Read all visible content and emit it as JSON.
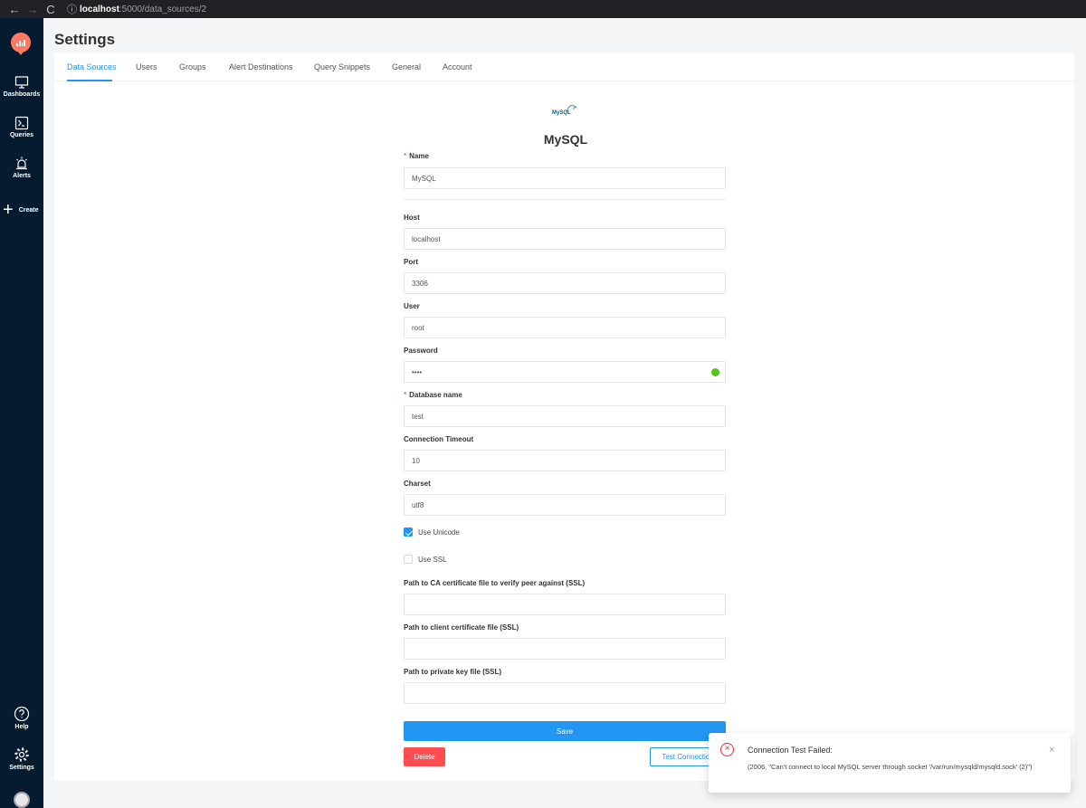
{
  "browser": {
    "url_host": "localhost",
    "url_rest": ":5000/data_sources/2"
  },
  "sidebar": {
    "items": [
      {
        "label": "Dashboards",
        "icon": "monitor-icon"
      },
      {
        "label": "Queries",
        "icon": "terminal-icon"
      },
      {
        "label": "Alerts",
        "icon": "alarm-icon"
      }
    ],
    "create_label": "Create",
    "help_label": "Help",
    "settings_label": "Settings"
  },
  "header": {
    "title": "Settings"
  },
  "tabs": [
    {
      "label": "Data Sources",
      "active": true
    },
    {
      "label": "Users"
    },
    {
      "label": "Groups"
    },
    {
      "label": "Alert Destinations"
    },
    {
      "label": "Query Snippets"
    },
    {
      "label": "General"
    },
    {
      "label": "Account"
    }
  ],
  "datasource": {
    "logo_text": "MySQL",
    "title": "MySQL"
  },
  "form": {
    "name": {
      "label": "Name",
      "value": "MySQL",
      "required": true
    },
    "host": {
      "label": "Host",
      "value": "localhost"
    },
    "port": {
      "label": "Port",
      "value": "3306"
    },
    "user": {
      "label": "User",
      "value": "root"
    },
    "password": {
      "label": "Password",
      "value": "••••"
    },
    "database": {
      "label": "Database name",
      "value": "test",
      "required": true
    },
    "timeout": {
      "label": "Connection Timeout",
      "value": "10"
    },
    "charset": {
      "label": "Charset",
      "value": "utf8"
    },
    "use_unicode": {
      "label": "Use Unicode",
      "checked": true
    },
    "use_ssl": {
      "label": "Use SSL",
      "checked": false
    },
    "ssl_ca": {
      "label": "Path to CA certificate file to verify peer against (SSL)",
      "value": ""
    },
    "ssl_cert": {
      "label": "Path to client certificate file (SSL)",
      "value": ""
    },
    "ssl_key": {
      "label": "Path to private key file (SSL)",
      "value": ""
    }
  },
  "buttons": {
    "save": "Save",
    "delete": "Delete",
    "test": "Test Connection"
  },
  "notification": {
    "title": "Connection Test Failed:",
    "message": "(2006, \"Can't connect to local MySQL server through socket '/var/run/mysqld/mysqld.sock' (2)\")",
    "close": "×"
  },
  "colors": {
    "primary": "#2196f3",
    "danger": "#ff4d4f",
    "sidebar": "#061a30",
    "success": "#52c41a"
  }
}
